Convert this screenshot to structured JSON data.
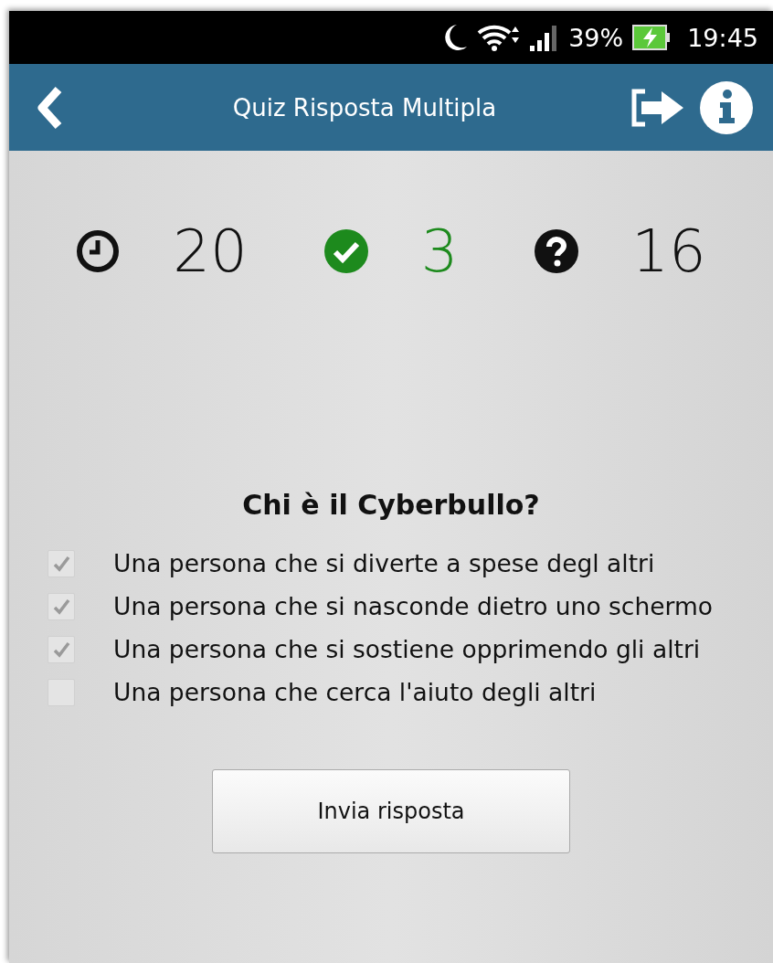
{
  "status_bar": {
    "battery": "39%",
    "time": "19:45"
  },
  "app_bar": {
    "title": "Quiz Risposta Multipla"
  },
  "stats": [
    {
      "kind": "timer",
      "value": "20"
    },
    {
      "kind": "correct",
      "value": "3"
    },
    {
      "kind": "unanswered",
      "value": "16"
    }
  ],
  "question": "Chi è il Cyberbullo?",
  "options": [
    {
      "label": "Una persona che si diverte a spese degl altri",
      "checked": true
    },
    {
      "label": "Una persona che si nasconde dietro uno schermo",
      "checked": true
    },
    {
      "label": "Una persona che si sostiene opprimendo gli altri",
      "checked": true
    },
    {
      "label": "Una persona che cerca l'aiuto degli altri",
      "checked": false
    }
  ],
  "submit_button": "Invia risposta"
}
